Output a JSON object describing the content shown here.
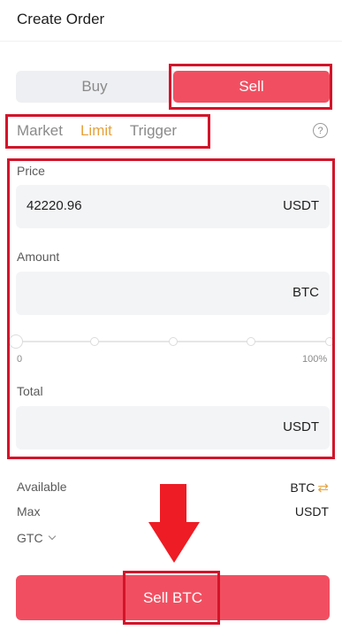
{
  "header": {
    "title": "Create Order"
  },
  "side_toggle": {
    "buy_label": "Buy",
    "sell_label": "Sell",
    "selected": "Sell"
  },
  "order_tabs": {
    "items": [
      {
        "label": "Market"
      },
      {
        "label": "Limit"
      },
      {
        "label": "Trigger"
      }
    ],
    "active": "Limit",
    "help_icon": "?"
  },
  "price": {
    "label": "Price",
    "value": "42220.96",
    "unit": "USDT"
  },
  "amount": {
    "label": "Amount",
    "value": "",
    "unit": "BTC"
  },
  "slider": {
    "min_label": "0",
    "max_label": "100%",
    "value_percent": 0
  },
  "total": {
    "label": "Total",
    "value": "",
    "unit": "USDT"
  },
  "available": {
    "label": "Available",
    "value": "BTC",
    "swap_icon": "⇄"
  },
  "max": {
    "label": "Max",
    "value": "USDT"
  },
  "time_in_force": {
    "value": "GTC"
  },
  "submit": {
    "label": "Sell BTC"
  },
  "colors": {
    "accent": "#f14f61",
    "active_tab": "#e6a23c",
    "annotation": "#d3142a"
  }
}
